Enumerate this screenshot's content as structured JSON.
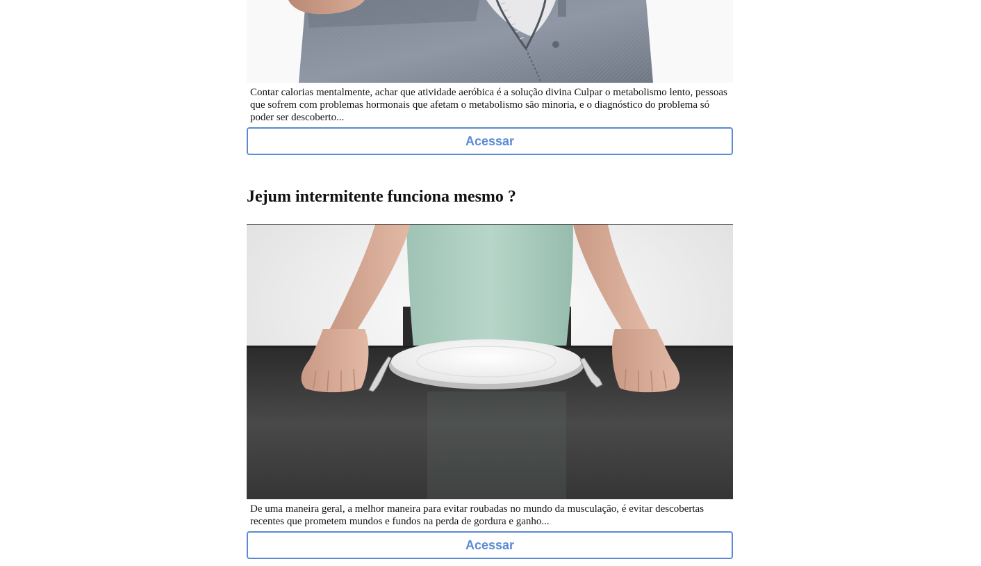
{
  "articles": [
    {
      "image": "jeans-photo",
      "excerpt": "Contar calorias mentalmente, achar que atividade aeróbica é a solução divina Culpar o metabolismo lento, pessoas que sofrem com problemas hormonais que afetam o metabolismo são minoria, e o diagnóstico do problema só poder ser descoberto...",
      "button_label": "Acessar"
    },
    {
      "title": "Jejum intermitente funciona mesmo ?",
      "image": "empty-plate-photo",
      "excerpt": "De uma maneira geral, a melhor maneira para evitar roubadas no mundo da musculação, é evitar descobertas recentes que prometem mundos e fundos na perda de gordura e ganho...",
      "button_label": "Acessar"
    }
  ],
  "colors": {
    "accent": "#5b8ad6",
    "text": "#111111",
    "background": "#ffffff"
  }
}
